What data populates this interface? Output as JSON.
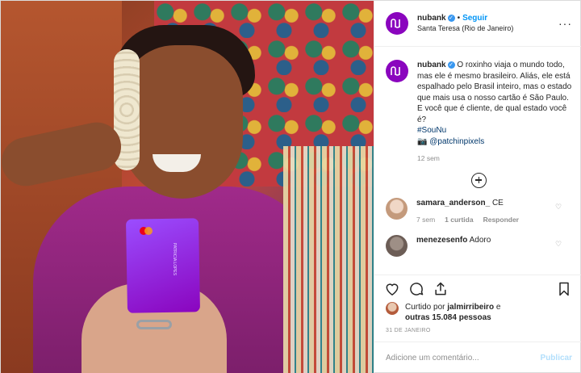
{
  "post": {
    "header": {
      "username": "nubank",
      "verified": true,
      "separator": "•",
      "follow_label": "Seguir",
      "location": "Santa Teresa (Rio de Janeiro)"
    },
    "caption": {
      "username": "nubank",
      "text": "O roxinho viaja o mundo todo, mas ele é mesmo brasileiro. Aliás, ele está espalhado pelo Brasil inteiro, mas o estado que mais usa o nosso cartão é São Paulo. E você que é cliente, de qual estado você é?",
      "hashtag": "#SouNu",
      "credit_icon": "camera-icon",
      "credit": "@patchinpixels",
      "time": "12 sem"
    },
    "comments": [
      {
        "username": "samara_anderson_",
        "text": "CE",
        "time": "7 sem",
        "likes": "1 curtida",
        "reply": "Responder"
      },
      {
        "username": "menezesenfo",
        "text": "Adoro"
      }
    ],
    "likes": {
      "prefix": "Curtido por",
      "user": "jalmirribeiro",
      "connector": "e",
      "others": "outras 15.084 pessoas"
    },
    "date": "31 DE JANEIRO",
    "add_comment": {
      "placeholder": "Adicione um comentário...",
      "publish_label": "Publicar"
    },
    "card": {
      "name": "PATRICIA LOPES"
    }
  },
  "colors": {
    "brand": "#8a05be",
    "link": "#0095f6",
    "muted": "#8e8e8e"
  }
}
